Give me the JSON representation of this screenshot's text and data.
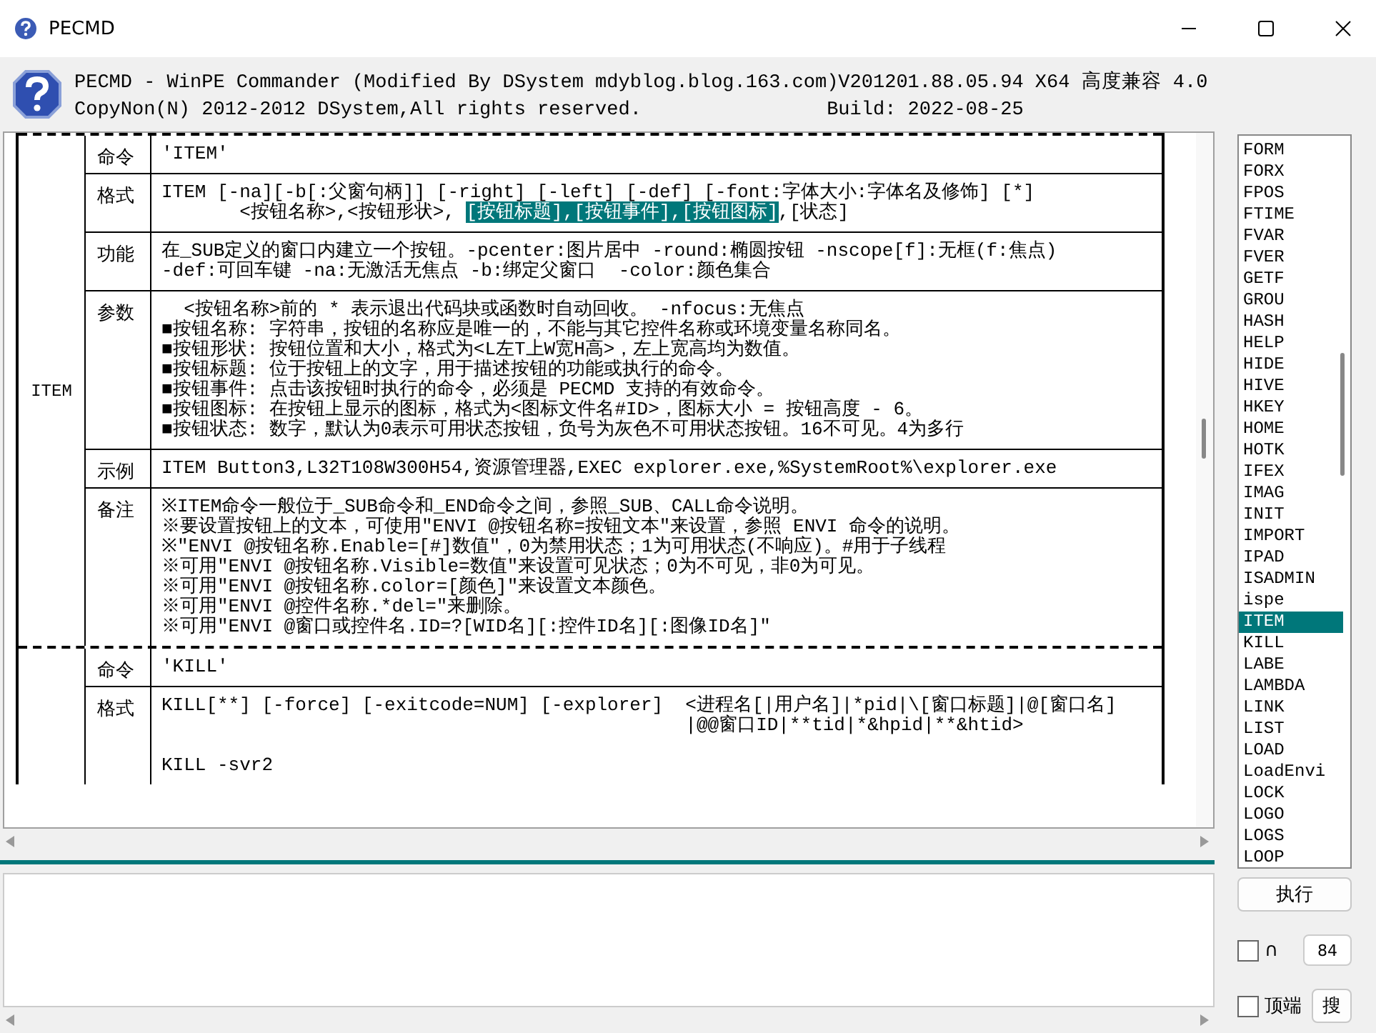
{
  "window": {
    "title": "PECMD"
  },
  "header": {
    "lines": [
      "PECMD - WinPE Commander (Modified By DSystem mdyblog.blog.163.com)V201201.88.05.94 X64 高度兼容 4.0",
      "CopyNon(N) 2012-2012 DSystem,All rights reserved.                Build: 2022-08-25"
    ]
  },
  "doc": {
    "entries": [
      {
        "name": "ITEM",
        "rows": [
          {
            "label": "命令",
            "paragraphs": [
              [
                "'ITEM'"
              ]
            ]
          },
          {
            "label": "格式",
            "paragraphs": [
              [
                "ITEM [-na][-b[:父窗句柄]] [-right] [-left] [-def] [-font:字体大小:字体名及修饰] [*]",
                [
                  {
                    "text": "       <按钮名称>,<按钮形状>, ",
                    "highlighted": false
                  },
                  {
                    "text": "[按钮标题],[按钮事件],[按钮图标]",
                    "highlighted": true
                  },
                  {
                    "text": ",[状态]",
                    "highlighted": false
                  }
                ]
              ]
            ]
          },
          {
            "label": "功能",
            "paragraphs": [
              [
                "在_SUB定义的窗口内建立一个按钮。-pcenter:图片居中 -round:椭圆按钮 -nscope[f]:无框(f:焦点)",
                "-def:可回车键 -na:无激活无焦点 -b:绑定父窗口  -color:颜色集合"
              ]
            ]
          },
          {
            "label": "参数",
            "paragraphs": [
              [
                "  <按钮名称>前的 * 表示退出代码块或函数时自动回收。 -nfocus:无焦点",
                "■按钮名称: 字符串，按钮的名称应是唯一的，不能与其它控件名称或环境变量名称同名。",
                "■按钮形状: 按钮位置和大小，格式为<L左T上W宽H高>，左上宽高均为数值。",
                "■按钮标题: 位于按钮上的文字，用于描述按钮的功能或执行的命令。",
                "■按钮事件: 点击该按钮时执行的命令，必须是 PECMD 支持的有效命令。",
                "■按钮图标: 在按钮上显示的图标，格式为<图标文件名#ID>，图标大小 = 按钮高度 - 6。",
                "■按钮状态: 数字，默认为0表示可用状态按钮，负号为灰色不可用状态按钮。16不可见。4为多行"
              ]
            ]
          },
          {
            "label": "示例",
            "paragraphs": [
              [
                "ITEM Button3,L32T108W300H54,资源管理器,EXEC explorer.exe,%SystemRoot%\\explorer.exe"
              ]
            ]
          },
          {
            "label": "备注",
            "paragraphs": [
              [
                "※ITEM命令一般位于_SUB命令和_END命令之间，参照_SUB、CALL命令说明。",
                "※要设置按钮上的文本，可使用\"ENVI @按钮名称=按钮文本\"来设置，参照 ENVI 命令的说明。",
                "※\"ENVI @按钮名称.Enable=[#]数值\"，0为禁用状态；1为可用状态(不响应)。#用于子线程",
                "※可用\"ENVI @按钮名称.Visible=数值\"来设置可见状态；0为不可见，非0为可见。",
                "※可用\"ENVI @按钮名称.color=[颜色]\"来设置文本颜色。",
                "※可用\"ENVI @控件名称.*del=\"来删除。",
                "※可用\"ENVI @窗口或控件名.ID=?[WID名][:控件ID名][:图像ID名]\""
              ]
            ]
          }
        ]
      },
      {
        "rows": [
          {
            "label": "命令",
            "paragraphs": [
              [
                "'KILL'"
              ]
            ]
          },
          {
            "label": "格式",
            "paragraphs": [
              [
                "KILL[**] [-force] [-exitcode=NUM] [-explorer]  <进程名[|用户名]|*pid|\\[窗口标题]|@[窗口名]",
                "                                               |@@窗口ID|**tid|*&hpid|**&htid>"
              ],
              [
                "KILL -svr2"
              ]
            ]
          }
        ]
      }
    ]
  },
  "commands": [
    {
      "label": "FORM",
      "selected": false
    },
    {
      "label": "FORX",
      "selected": false
    },
    {
      "label": "FPOS",
      "selected": false
    },
    {
      "label": "FTIME",
      "selected": false
    },
    {
      "label": "FVAR",
      "selected": false
    },
    {
      "label": "FVER",
      "selected": false
    },
    {
      "label": "GETF",
      "selected": false
    },
    {
      "label": "GROU",
      "selected": false
    },
    {
      "label": "HASH",
      "selected": false
    },
    {
      "label": "HELP",
      "selected": false
    },
    {
      "label": "HIDE",
      "selected": false
    },
    {
      "label": "HIVE",
      "selected": false
    },
    {
      "label": "HKEY",
      "selected": false
    },
    {
      "label": "HOME",
      "selected": false
    },
    {
      "label": "HOTK",
      "selected": false
    },
    {
      "label": "IFEX",
      "selected": false
    },
    {
      "label": "IMAG",
      "selected": false
    },
    {
      "label": "INIT",
      "selected": false
    },
    {
      "label": "IMPORT",
      "selected": false
    },
    {
      "label": "IPAD",
      "selected": false
    },
    {
      "label": "ISADMIN",
      "selected": false
    },
    {
      "label": "ispe",
      "selected": false
    },
    {
      "label": "ITEM",
      "selected": true
    },
    {
      "label": "KILL",
      "selected": false
    },
    {
      "label": "LABE",
      "selected": false
    },
    {
      "label": "LAMBDA",
      "selected": false
    },
    {
      "label": "LINK",
      "selected": false
    },
    {
      "label": "LIST",
      "selected": false
    },
    {
      "label": "LOAD",
      "selected": false
    },
    {
      "label": "LoadEnvi",
      "selected": false
    },
    {
      "label": "LOCK",
      "selected": false
    },
    {
      "label": "LOGO",
      "selected": false
    },
    {
      "label": "LOGS",
      "selected": false
    },
    {
      "label": "LOOP",
      "selected": false
    }
  ],
  "run_button": "执行",
  "cap_option": {
    "label": "∩",
    "checked": false,
    "value": "84"
  },
  "top_option": {
    "label": "顶端",
    "checked": false
  },
  "search_button": "搜"
}
